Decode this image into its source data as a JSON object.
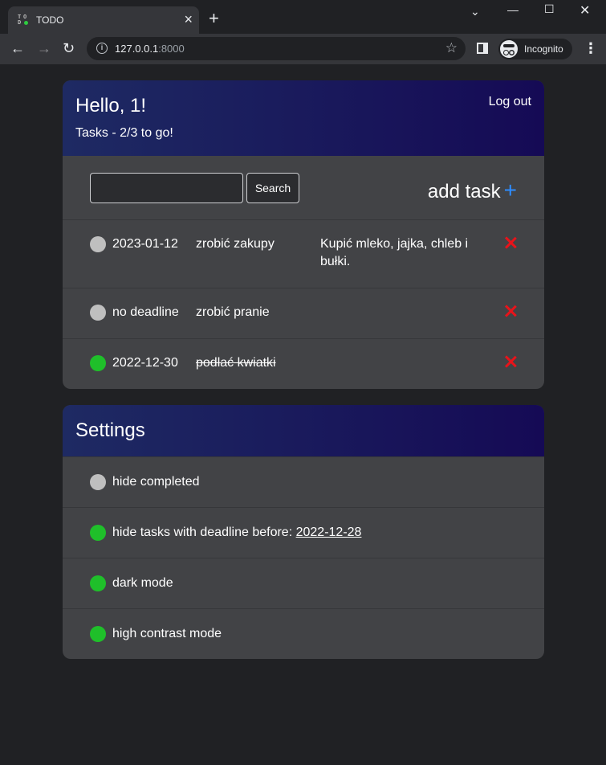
{
  "browser": {
    "tab_title": "TODO",
    "favicon": {
      "letters": [
        "T",
        "O",
        "D"
      ]
    },
    "url_host": "127.0.0.1",
    "url_port": ":8000",
    "incognito_label": "Incognito"
  },
  "header": {
    "greeting": "Hello, 1!",
    "progress": "Tasks - 2/3 to go!",
    "logout_label": "Log out"
  },
  "toolbar": {
    "search_value": "",
    "search_button": "Search",
    "add_task_label": "add task",
    "add_task_icon": "+"
  },
  "tasks": [
    {
      "done": false,
      "date": "2023-01-12",
      "title": "zrobić zakupy",
      "description": "Kupić mleko, jajka, chleb i bułki."
    },
    {
      "done": false,
      "date": "no deadline",
      "title": "zrobić pranie",
      "description": ""
    },
    {
      "done": true,
      "date": "2022-12-30",
      "title": "podlać kwiatki",
      "description": ""
    }
  ],
  "settings": {
    "title": "Settings",
    "items": [
      {
        "enabled": false,
        "label": "hide completed"
      },
      {
        "enabled": true,
        "label": "hide tasks with deadline before: ",
        "date": "2022-12-28"
      },
      {
        "enabled": true,
        "label": "dark mode"
      },
      {
        "enabled": true,
        "label": "high contrast mode"
      }
    ]
  },
  "colors": {
    "toggle_on": "#1fbf2a",
    "toggle_off": "#bfbfbf",
    "delete": "#e8131a",
    "accent_plus": "#2d8cff",
    "header_gradient_start": "#1e2a63",
    "header_gradient_end": "#150a55"
  }
}
